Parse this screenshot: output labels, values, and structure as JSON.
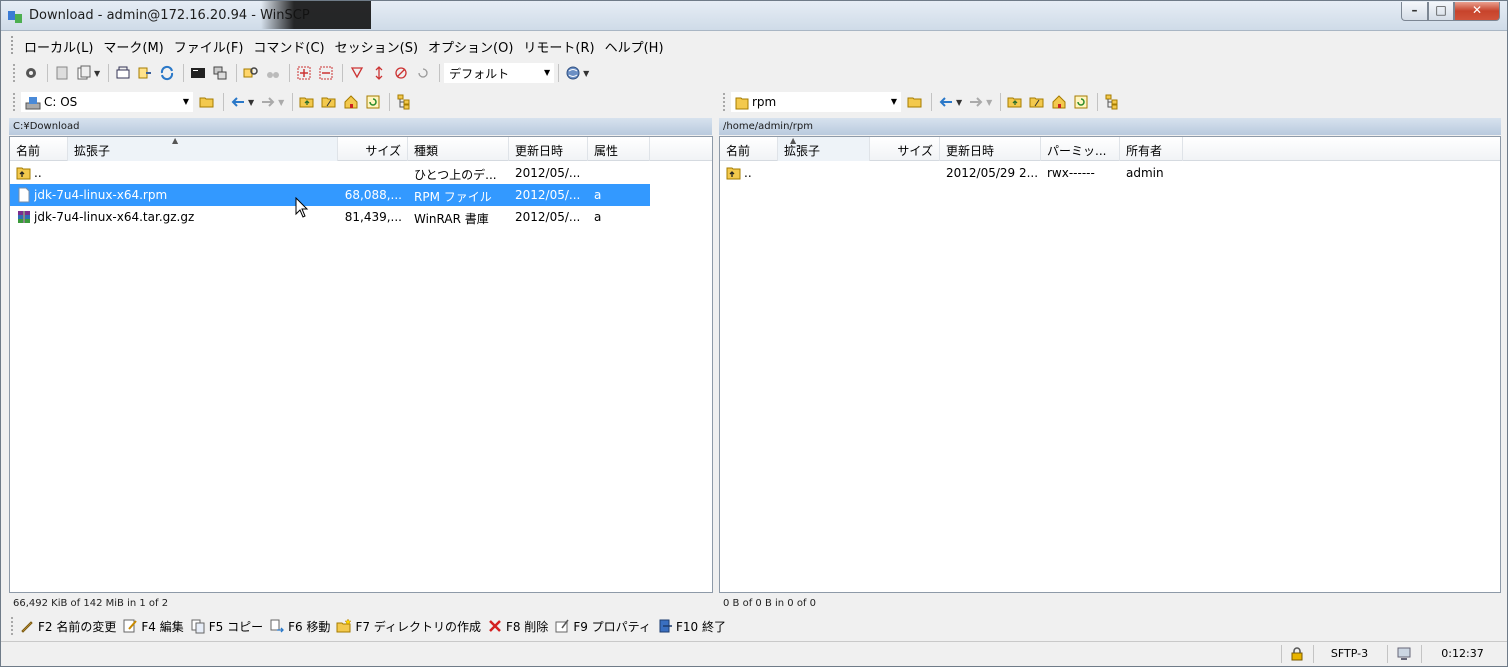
{
  "window": {
    "title": "Download - admin@172.16.20.94 - WinSCP"
  },
  "menu": [
    "ローカル(L)",
    "マーク(M)",
    "ファイル(F)",
    "コマンド(C)",
    "セッション(S)",
    "オプション(O)",
    "リモート(R)",
    "ヘルプ(H)"
  ],
  "toolbar": {
    "transfer_preset": "デフォルト"
  },
  "left": {
    "drive": "C: OS",
    "path": "C:¥Download",
    "columns": [
      "名前",
      "拡張子",
      "サイズ",
      "種類",
      "更新日時",
      "属性"
    ],
    "rows": [
      {
        "name": "..",
        "size": "",
        "type": "ひとつ上のデ...",
        "modified": "2012/05/...",
        "attr": ""
      },
      {
        "name": "jdk-7u4-linux-x64.rpm",
        "size": "68,088,...",
        "type": "RPM ファイル",
        "modified": "2012/05/...",
        "attr": "a"
      },
      {
        "name": "jdk-7u4-linux-x64.tar.gz.gz",
        "size": "81,439,...",
        "type": "WinRAR 書庫",
        "modified": "2012/05/...",
        "attr": "a"
      }
    ],
    "status": "66,492 KiB of 142 MiB in 1 of 2"
  },
  "right": {
    "dir": "rpm",
    "path": "/home/admin/rpm",
    "columns": [
      "名前",
      "拡張子",
      "サイズ",
      "更新日時",
      "パーミッ...",
      "所有者"
    ],
    "rows": [
      {
        "name": "..",
        "size": "",
        "modified": "2012/05/29 2...",
        "perm": "rwx------",
        "owner": "admin"
      }
    ],
    "status": "0 B of 0 B in 0 of 0"
  },
  "fkeys": [
    {
      "label": "F2 名前の変更",
      "icon": "rename-icon"
    },
    {
      "label": "F4 編集",
      "icon": "edit-icon"
    },
    {
      "label": "F5 コピー",
      "icon": "copy-icon"
    },
    {
      "label": "F6 移動",
      "icon": "move-icon"
    },
    {
      "label": "F7 ディレクトリの作成",
      "icon": "new-folder-icon"
    },
    {
      "label": "F8 削除",
      "icon": "delete-icon"
    },
    {
      "label": "F9 プロパティ",
      "icon": "properties-icon"
    },
    {
      "label": "F10 終了",
      "icon": "exit-icon"
    }
  ],
  "statusbar": {
    "protocol": "SFTP-3",
    "elapsed": "0:12:37"
  },
  "colors": {
    "selection": "#3399ff",
    "pathbar": "#c6d5e6"
  }
}
